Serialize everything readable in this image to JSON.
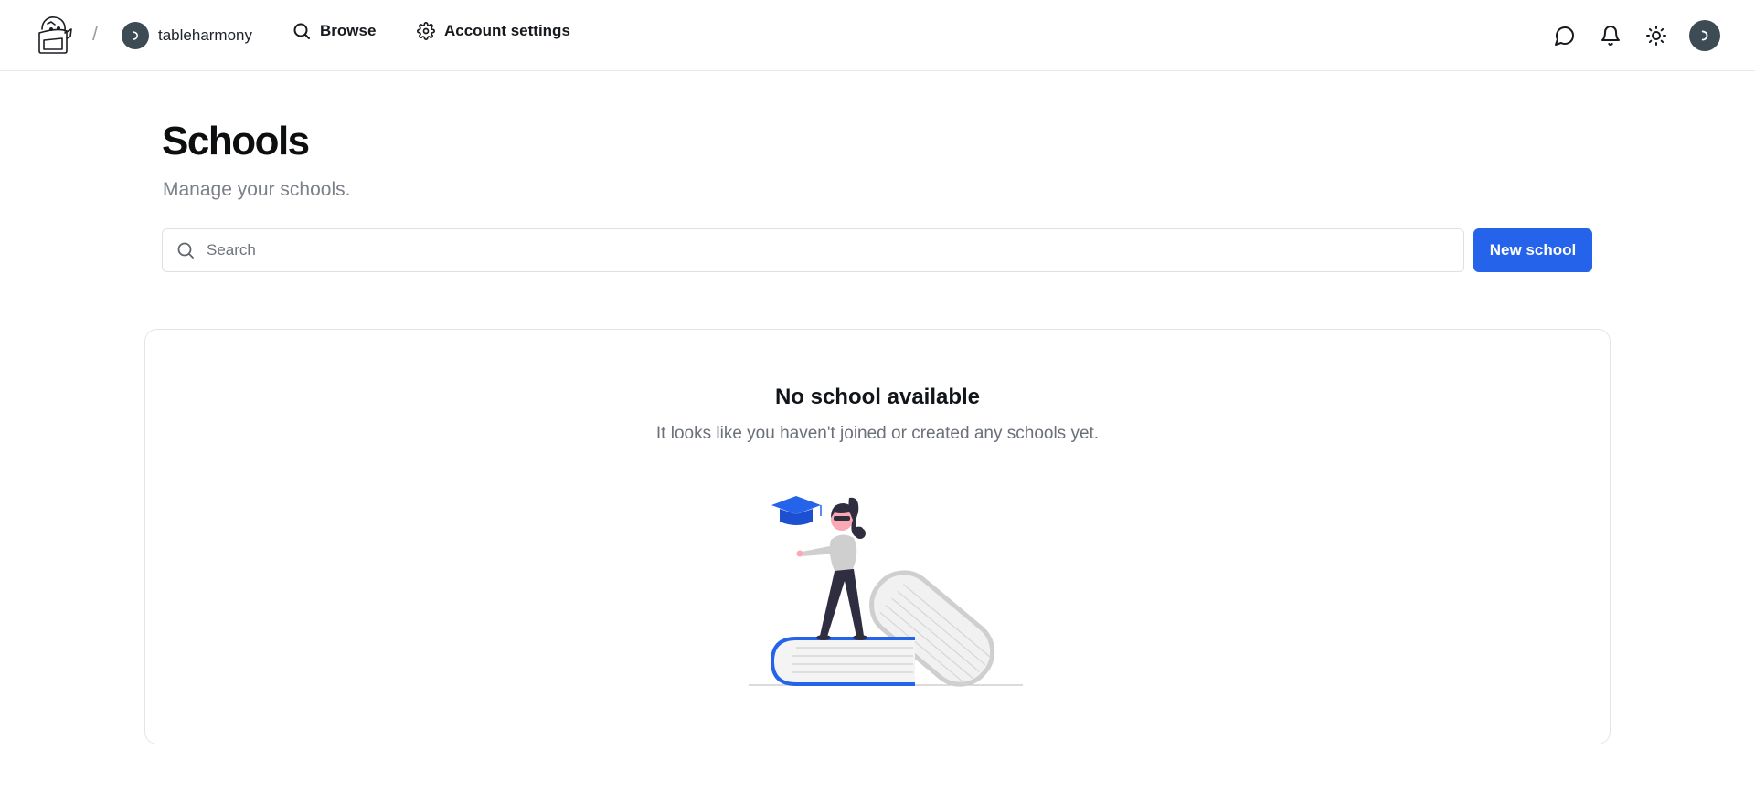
{
  "topbar": {
    "logo_icon": "backpack-logo-icon",
    "separator": "/",
    "org_name": "tableharmony",
    "nav": {
      "browse_label": "Browse",
      "settings_label": "Account settings"
    },
    "icons": [
      "chat-icon",
      "bell-icon",
      "sun-icon"
    ]
  },
  "header": {
    "title": "Schools",
    "subtitle": "Manage your schools."
  },
  "search": {
    "placeholder": "Search",
    "value": ""
  },
  "actions": {
    "new_school_label": "New school"
  },
  "empty_state": {
    "title": "No school available",
    "message": "It looks like you haven't joined or created any schools yet.",
    "illustration": "student-on-books-illustration"
  },
  "colors": {
    "accent": "#2563eb",
    "avatar": "#3d4b55",
    "border": "#e3e5e8"
  }
}
